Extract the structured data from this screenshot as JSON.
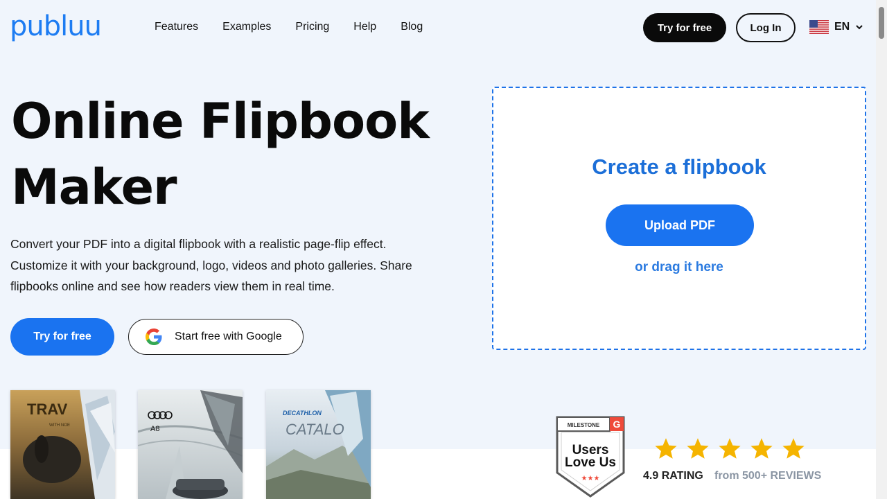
{
  "header": {
    "logo": "publuu",
    "nav": [
      "Features",
      "Examples",
      "Pricing",
      "Help",
      "Blog"
    ],
    "try_free": "Try for free",
    "login": "Log In",
    "language": "EN"
  },
  "hero": {
    "title_line1": "Online Flipbook",
    "title_line2": "Maker",
    "description": "Convert your PDF into a digital flipbook with a realistic page-flip effect. Customize it with your background, logo, videos and photo galleries. Share flipbooks online and see how readers view them in real time.",
    "try_free": "Try for free",
    "google": "Start free with Google"
  },
  "upload": {
    "title": "Create a flipbook",
    "button": "Upload PDF",
    "drag": "or drag it here"
  },
  "thumbnails": [
    {
      "title": "TRAV",
      "subtitle": "WITH NOE",
      "icon": "travel-magazine"
    },
    {
      "title": "A8",
      "icon": "audi-catalog"
    },
    {
      "title": "CATALO",
      "brand": "DECATHLON",
      "icon": "sports-catalog"
    }
  ],
  "badge": {
    "top": "MILESTONE",
    "line1": "Users",
    "line2": "Love Us",
    "g_letter": "G"
  },
  "rating": {
    "stars": 5,
    "value": "4.9 RATING",
    "reviews": "from 500+ REVIEWS"
  },
  "colors": {
    "primary": "#1a73f0",
    "background": "#f0f5fc",
    "dark_button": "#0a0a0a",
    "star": "#f5b400"
  }
}
